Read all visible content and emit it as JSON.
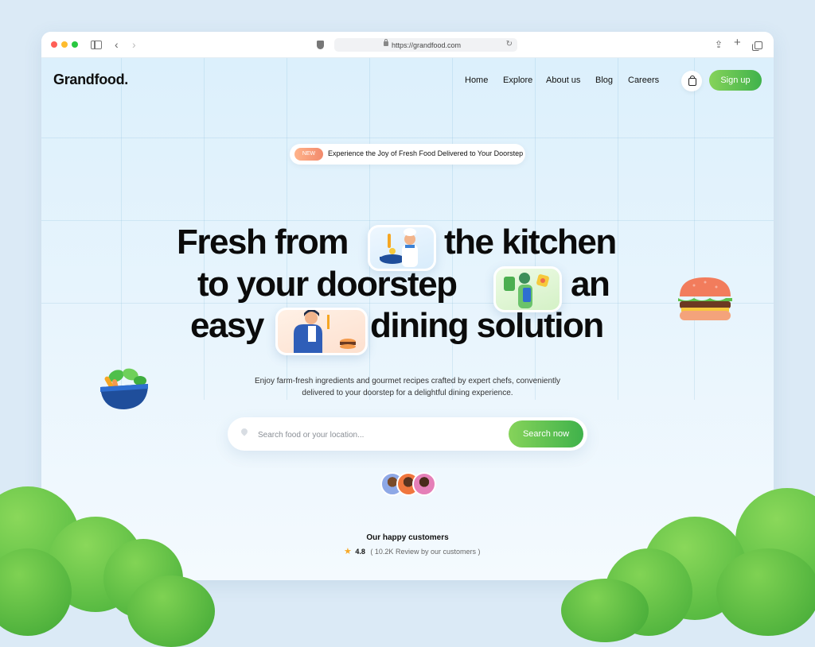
{
  "browser": {
    "url": "https://grandfood.com"
  },
  "nav": {
    "logo": "Grandfood.",
    "links": [
      "Home",
      "Explore",
      "About us",
      "Blog",
      "Careers"
    ],
    "signup": "Sign up"
  },
  "hero": {
    "badge": "NEW",
    "announcement": "Experience the Joy of Fresh Food Delivered to Your Doorstep",
    "headline_line1_a": "Fresh from",
    "headline_line1_b": "the kitchen",
    "headline_line2_a": "to your doorstep",
    "headline_line2_b": "an",
    "headline_line3_a": "easy",
    "headline_line3_b": "dining solution",
    "description_line1": "Enjoy farm-fresh ingredients and gourmet recipes crafted by expert chefs, conveniently",
    "description_line2": "delivered to your doorstep for a delightful dining experience."
  },
  "search": {
    "placeholder": "Search food or your location...",
    "value": "",
    "button": "Search now"
  },
  "customers": {
    "title": "Our happy customers",
    "rating": "4.8",
    "reviews": "( 10.2K Review by our customers )"
  },
  "colors": {
    "accent_green": "#3fb24b",
    "badge_orange": "#f28a6c",
    "star": "#f7a928"
  },
  "icons": [
    "sidebar-icon",
    "back-icon",
    "forward-icon",
    "shield-icon",
    "lock-icon",
    "reload-icon",
    "share-icon",
    "new-tab-icon",
    "tabs-icon",
    "cart-icon",
    "location-pin-icon",
    "star-icon"
  ]
}
